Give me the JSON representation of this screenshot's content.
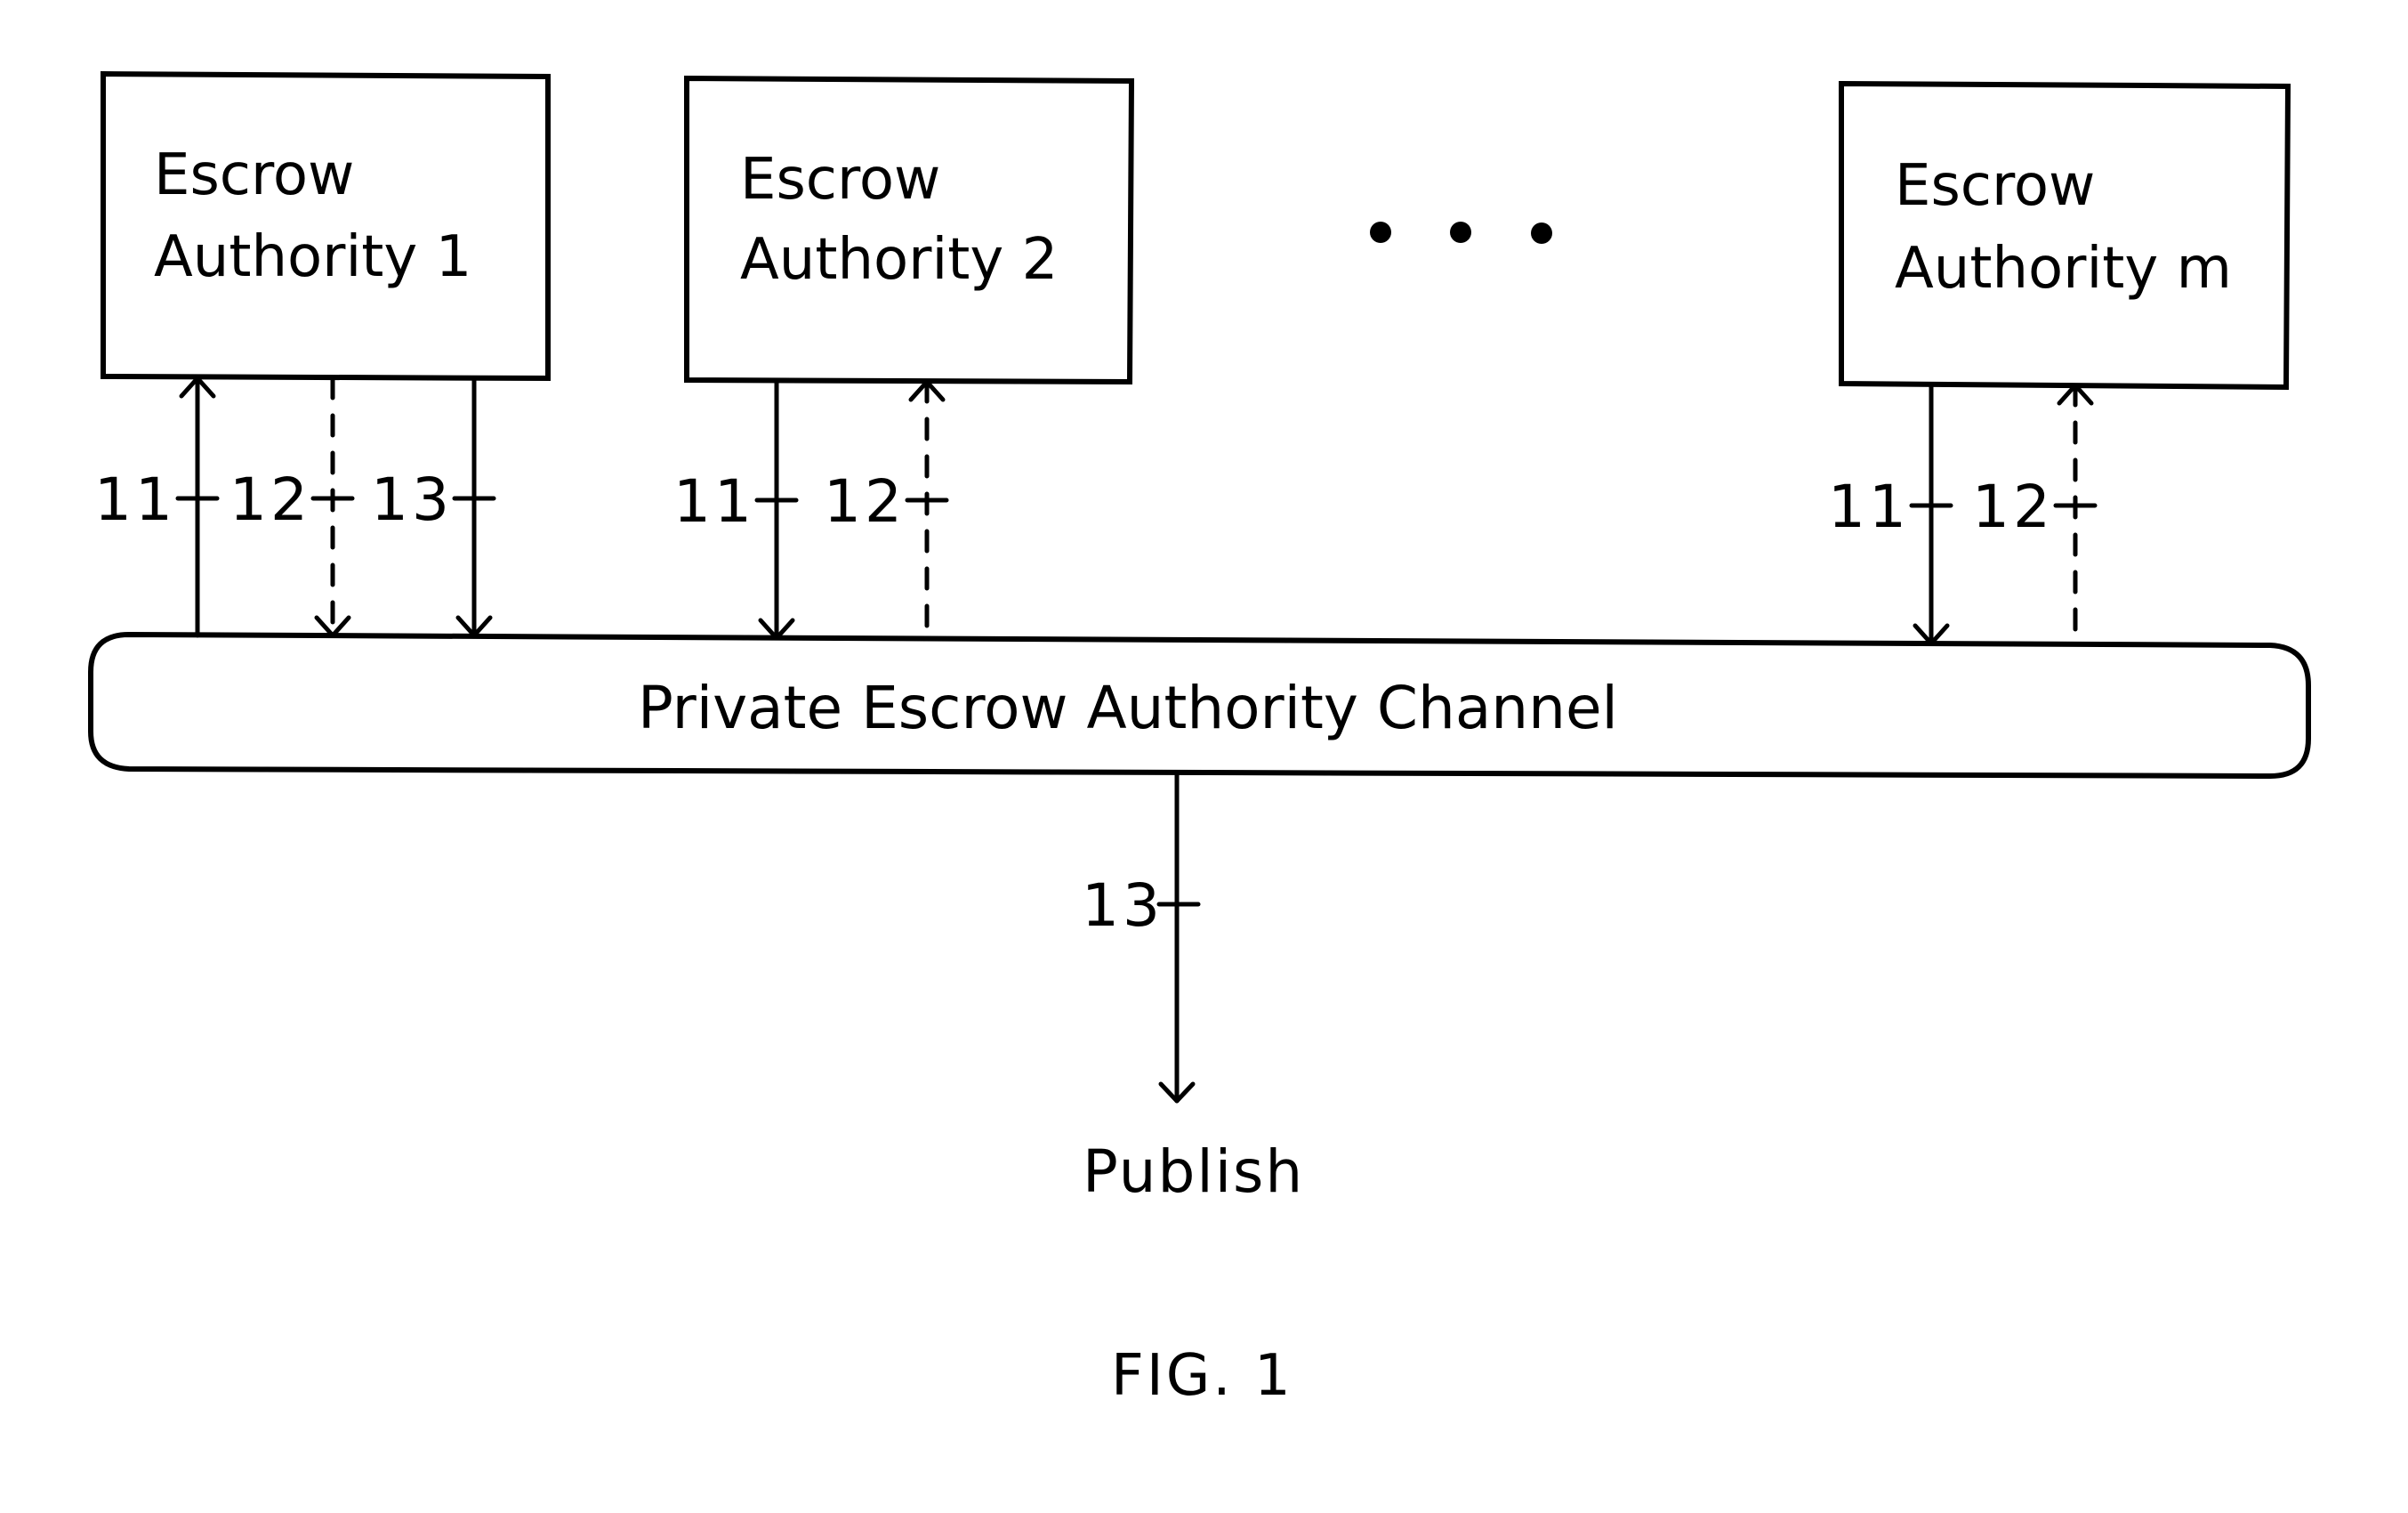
{
  "figure_label": "FIG. 1",
  "ellipsis_icon": "ellipsis-dots",
  "authorities": [
    {
      "id": "authority-1",
      "line1": "Escrow",
      "line2": "Authority 1",
      "connections": [
        {
          "label": "11",
          "direction": "up",
          "style": "solid"
        },
        {
          "label": "12",
          "direction": "down",
          "style": "dashed"
        },
        {
          "label": "13",
          "direction": "down",
          "style": "solid"
        }
      ]
    },
    {
      "id": "authority-2",
      "line1": "Escrow",
      "line2": "Authority 2",
      "connections": [
        {
          "label": "11",
          "direction": "down",
          "style": "solid"
        },
        {
          "label": "12",
          "direction": "up",
          "style": "dashed"
        }
      ]
    },
    {
      "id": "authority-m",
      "line1": "Escrow",
      "line2": "Authority m",
      "connections": [
        {
          "label": "11",
          "direction": "down",
          "style": "solid"
        },
        {
          "label": "12",
          "direction": "up",
          "style": "dashed"
        }
      ]
    }
  ],
  "channel": {
    "label": "Private Escrow Authority Channel"
  },
  "output": {
    "label": "13",
    "direction": "down",
    "style": "solid",
    "target": "Publish"
  }
}
